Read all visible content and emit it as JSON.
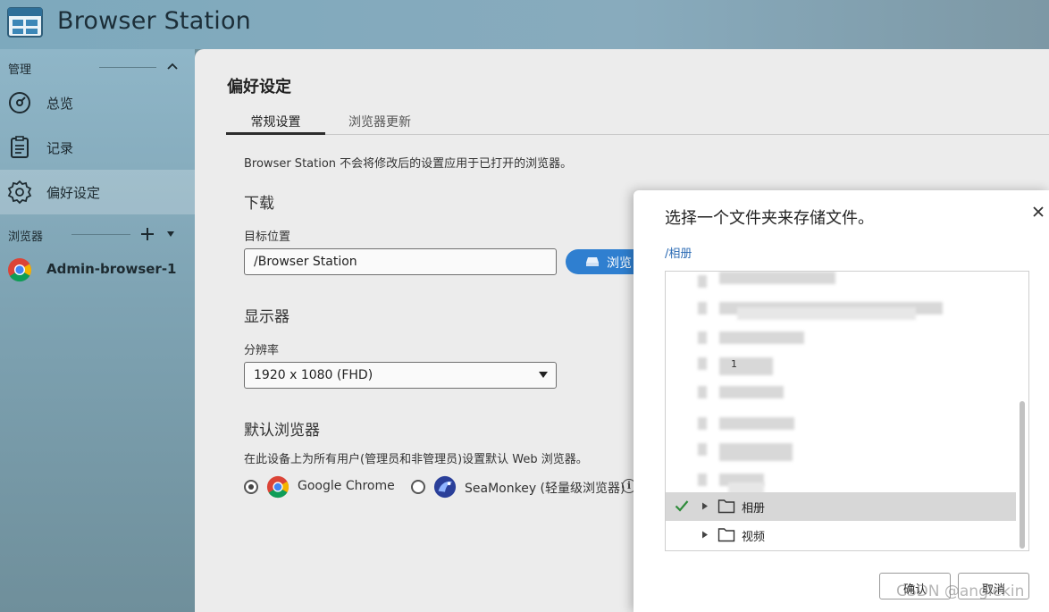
{
  "app": {
    "title": "Browser Station"
  },
  "sidebar": {
    "manage_label": "管理",
    "items": [
      {
        "label": "总览",
        "icon": "overview-icon"
      },
      {
        "label": "记录",
        "icon": "log-icon"
      },
      {
        "label": "偏好设定",
        "icon": "gear-icon",
        "active": true
      }
    ],
    "browsers_label": "浏览器",
    "browsers": [
      {
        "label": "Admin-browser-1",
        "icon": "chrome-icon"
      }
    ]
  },
  "main": {
    "title": "偏好设定",
    "tabs": [
      {
        "label": "常规设置",
        "active": true
      },
      {
        "label": "浏览器更新"
      }
    ],
    "notice": "Browser Station 不会将修改后的设置应用于已打开的浏览器。",
    "download": {
      "heading": "下载",
      "target_label": "目标位置",
      "target_value": "/Browser Station",
      "browse_label": "浏览"
    },
    "display": {
      "heading": "显示器",
      "resolution_label": "分辨率",
      "resolution_value": "1920 x 1080 (FHD)"
    },
    "default_browser": {
      "heading": "默认浏览器",
      "description": "在此设备上为所有用户(管理员和非管理员)设置默认 Web 浏览器。",
      "options": [
        {
          "label": "Google Chrome",
          "selected": true,
          "icon": "chrome-icon"
        },
        {
          "label": "SeaMonkey (轻量级浏览器)",
          "selected": false,
          "icon": "seamonkey-icon"
        }
      ]
    }
  },
  "dialog": {
    "title": "选择一个文件夹来存储文件。",
    "path": "/相册",
    "blurred_item_text": "1",
    "folders": [
      {
        "name": "相册",
        "selected": true
      },
      {
        "name": "视频",
        "selected": false
      }
    ],
    "confirm_label": "确认",
    "cancel_label": "取消"
  },
  "watermark": "CSDN @anglekin",
  "colors": {
    "accent": "#2f7fd0",
    "path_link": "#2b6bb4",
    "check": "#2e8b3a"
  }
}
